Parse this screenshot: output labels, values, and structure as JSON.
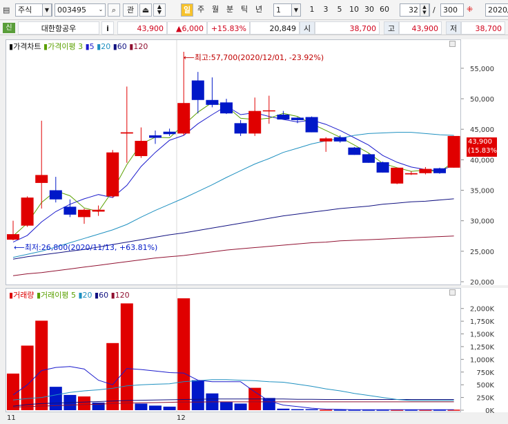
{
  "toolbar": {
    "market": "주식",
    "code": "003495",
    "search_icon": "search-icon",
    "btn_gwan": "관",
    "period_active": "일",
    "periods": [
      "주",
      "월",
      "분",
      "틱",
      "년"
    ],
    "interval_value": "1",
    "intervals": [
      "1",
      "3",
      "5",
      "10",
      "30",
      "60"
    ],
    "count_value": "32",
    "separator": "/",
    "total_value": "300",
    "date_value": "2020/"
  },
  "quote": {
    "badge": "신",
    "stock_name": "대한항공우",
    "info_btn": "i",
    "price": "43,900",
    "change": "▲6,000",
    "change_pct": "+15.83%",
    "volume": "20,849",
    "open_label": "시",
    "open": "38,700",
    "high_label": "고",
    "high": "43,900",
    "low_label": "저",
    "low": "38,700"
  },
  "price_legend": {
    "title": "가격차트",
    "ma_label": "가격이평",
    "ma_periods": [
      "3",
      "5",
      "20",
      "60",
      "120"
    ],
    "high_annotation": "최고:57,700(2020/12/01, -23.92%)",
    "low_annotation": "최저:26,800(2020/11/13, +63.81%)",
    "last_price_tag": "43,900",
    "last_pct_tag": "(15.83%)"
  },
  "volume_legend": {
    "title": "거래량",
    "ma_label": "거래이평",
    "ma_periods": [
      "5",
      "20",
      "60",
      "120"
    ]
  },
  "x_labels": [
    "11",
    "12"
  ],
  "colors": {
    "up": "#e00000",
    "down": "#0018c8",
    "ma3": "#5aa000",
    "ma5": "#1a1acc",
    "ma20": "#1e90c0",
    "ma60": "#101080",
    "ma120": "#901030"
  },
  "chart_data": [
    {
      "type": "candlestick",
      "title": "가격차트",
      "ylim": [
        20000,
        57700
      ],
      "y_ticks": [
        "55,000",
        "50,000",
        "45,000",
        "40,000",
        "35,000",
        "30,000",
        "25,000",
        "20,000"
      ],
      "candles": [
        {
          "o": 26900,
          "h": 30000,
          "l": 26800,
          "c": 27800
        },
        {
          "o": 29200,
          "h": 34000,
          "l": 29000,
          "c": 33800
        },
        {
          "o": 36200,
          "h": 46400,
          "l": 32000,
          "c": 37500
        },
        {
          "o": 35000,
          "h": 37200,
          "l": 33000,
          "c": 33500
        },
        {
          "o": 32300,
          "h": 33500,
          "l": 30600,
          "c": 31000
        },
        {
          "o": 30600,
          "h": 32000,
          "l": 29500,
          "c": 31800
        },
        {
          "o": 31500,
          "h": 32500,
          "l": 30800,
          "c": 31800
        },
        {
          "o": 34000,
          "h": 41600,
          "l": 33800,
          "c": 41200
        },
        {
          "o": 44300,
          "h": 52000,
          "l": 39500,
          "c": 44500
        },
        {
          "o": 40600,
          "h": 45300,
          "l": 40300,
          "c": 43100
        },
        {
          "o": 44000,
          "h": 44800,
          "l": 42600,
          "c": 43600
        },
        {
          "o": 44600,
          "h": 45100,
          "l": 43900,
          "c": 44200
        },
        {
          "o": 44300,
          "h": 57700,
          "l": 44000,
          "c": 49300
        },
        {
          "o": 53000,
          "h": 54400,
          "l": 47600,
          "c": 49800
        },
        {
          "o": 49800,
          "h": 53500,
          "l": 48600,
          "c": 49000
        },
        {
          "o": 49400,
          "h": 50000,
          "l": 47500,
          "c": 47600
        },
        {
          "o": 46000,
          "h": 46500,
          "l": 43900,
          "c": 44300
        },
        {
          "o": 44300,
          "h": 50200,
          "l": 43900,
          "c": 48000
        },
        {
          "o": 48000,
          "h": 50500,
          "l": 45900,
          "c": 48100
        },
        {
          "o": 47400,
          "h": 48000,
          "l": 46600,
          "c": 46600
        },
        {
          "o": 46900,
          "h": 47000,
          "l": 46000,
          "c": 46500
        },
        {
          "o": 47000,
          "h": 47100,
          "l": 44500,
          "c": 44500
        },
        {
          "o": 43000,
          "h": 43700,
          "l": 41300,
          "c": 43500
        },
        {
          "o": 43700,
          "h": 44000,
          "l": 42800,
          "c": 43000
        },
        {
          "o": 42000,
          "h": 42100,
          "l": 40800,
          "c": 40800
        },
        {
          "o": 40900,
          "h": 41000,
          "l": 39500,
          "c": 39500
        },
        {
          "o": 39600,
          "h": 39700,
          "l": 37900,
          "c": 37900
        },
        {
          "o": 36100,
          "h": 38600,
          "l": 36000,
          "c": 38700
        },
        {
          "o": 37600,
          "h": 38100,
          "l": 37500,
          "c": 37800
        },
        {
          "o": 37800,
          "h": 38800,
          "l": 37600,
          "c": 38500
        },
        {
          "o": 38600,
          "h": 38700,
          "l": 37700,
          "c": 37800
        },
        {
          "o": 38700,
          "h": 43900,
          "l": 38700,
          "c": 43900
        }
      ],
      "ma3": [
        27500,
        29600,
        33000,
        34900,
        34100,
        32100,
        31500,
        34900,
        39200,
        42600,
        43700,
        43600,
        45700,
        47800,
        49400,
        48800,
        46800,
        46600,
        46800,
        47600,
        47100,
        45900,
        44800,
        43700,
        42400,
        41100,
        39400,
        38700,
        38100,
        38300,
        38000,
        39700
      ],
      "ma5": [
        26500,
        27600,
        29800,
        31500,
        32700,
        33600,
        34300,
        33800,
        35800,
        38900,
        41200,
        43200,
        44000,
        45900,
        47400,
        48800,
        47400,
        47700,
        47100,
        46600,
        46200,
        46500,
        45800,
        44800,
        43600,
        42400,
        40700,
        39600,
        38800,
        38400,
        38200,
        39100
      ],
      "ma20": [
        24000,
        24500,
        25000,
        25700,
        26400,
        27100,
        27800,
        28500,
        29400,
        30600,
        31700,
        32700,
        33700,
        34800,
        35900,
        37100,
        38200,
        39300,
        40200,
        41200,
        41900,
        42600,
        43100,
        43500,
        44000,
        44300,
        44400,
        44500,
        44500,
        44300,
        44100,
        44000
      ],
      "ma60": [
        23700,
        24100,
        24400,
        24700,
        25000,
        25300,
        25700,
        26100,
        26500,
        26900,
        27300,
        27700,
        28000,
        28400,
        28800,
        29200,
        29600,
        30000,
        30400,
        30800,
        31100,
        31400,
        31700,
        32000,
        32200,
        32400,
        32700,
        32900,
        33100,
        33200,
        33400,
        33600
      ],
      "ma120": [
        21000,
        21300,
        21500,
        21800,
        22100,
        22400,
        22700,
        23000,
        23300,
        23600,
        23900,
        24100,
        24300,
        24600,
        24900,
        25200,
        25400,
        25600,
        25800,
        26000,
        26200,
        26400,
        26500,
        26700,
        26800,
        26900,
        27000,
        27100,
        27200,
        27300,
        27400,
        27500
      ]
    },
    {
      "type": "bar",
      "title": "거래량",
      "ylim": [
        0,
        2200000
      ],
      "y_ticks": [
        "2,000K",
        "1,750K",
        "1,500K",
        "1,250K",
        "1,000K",
        "750K",
        "500K",
        "250K",
        "0K"
      ],
      "volumes": [
        720000,
        1270000,
        1760000,
        460000,
        300000,
        270000,
        150000,
        1320000,
        2100000,
        130000,
        90000,
        70000,
        2200000,
        590000,
        330000,
        160000,
        130000,
        440000,
        240000,
        30000,
        20000,
        20000,
        10000,
        10000,
        10000,
        10000,
        10000,
        10000,
        10000,
        10000,
        10000,
        10000
      ],
      "up": [
        true,
        true,
        true,
        false,
        false,
        true,
        false,
        true,
        true,
        false,
        false,
        false,
        true,
        false,
        false,
        false,
        false,
        true,
        false,
        false,
        false,
        false,
        true,
        false,
        false,
        false,
        false,
        true,
        false,
        true,
        false,
        true
      ],
      "ma5": [
        300000,
        500000,
        780000,
        840000,
        860000,
        810000,
        590000,
        500000,
        820000,
        800000,
        770000,
        740000,
        730000,
        590000,
        560000,
        560000,
        560000,
        360000,
        180000,
        100000,
        70000,
        40000,
        20000,
        15000,
        10000,
        10000,
        10000,
        10000,
        10000,
        10000,
        10000,
        10000
      ],
      "ma20": [
        200000,
        230000,
        250000,
        300000,
        350000,
        380000,
        400000,
        430000,
        480000,
        500000,
        510000,
        520000,
        560000,
        580000,
        600000,
        600000,
        590000,
        580000,
        560000,
        550000,
        510000,
        470000,
        420000,
        380000,
        330000,
        290000,
        250000,
        210000,
        190000,
        190000,
        190000,
        190000
      ],
      "ma60": [
        80000,
        110000,
        130000,
        140000,
        150000,
        160000,
        170000,
        180000,
        190000,
        195000,
        200000,
        205000,
        210000,
        215000,
        220000,
        220000,
        220000,
        220000,
        220000,
        220000,
        215000,
        215000,
        210000,
        210000,
        210000,
        210000,
        210000,
        210000,
        210000,
        210000,
        210000,
        210000
      ],
      "ma120": [
        60000,
        70000,
        80000,
        90000,
        100000,
        110000,
        120000,
        130000,
        140000,
        145000,
        150000,
        155000,
        160000,
        160000,
        165000,
        165000,
        165000,
        165000,
        165000,
        165000,
        165000,
        165000,
        165000,
        165000,
        165000,
        165000,
        165000,
        165000,
        165000,
        165000,
        165000,
        165000
      ]
    }
  ]
}
